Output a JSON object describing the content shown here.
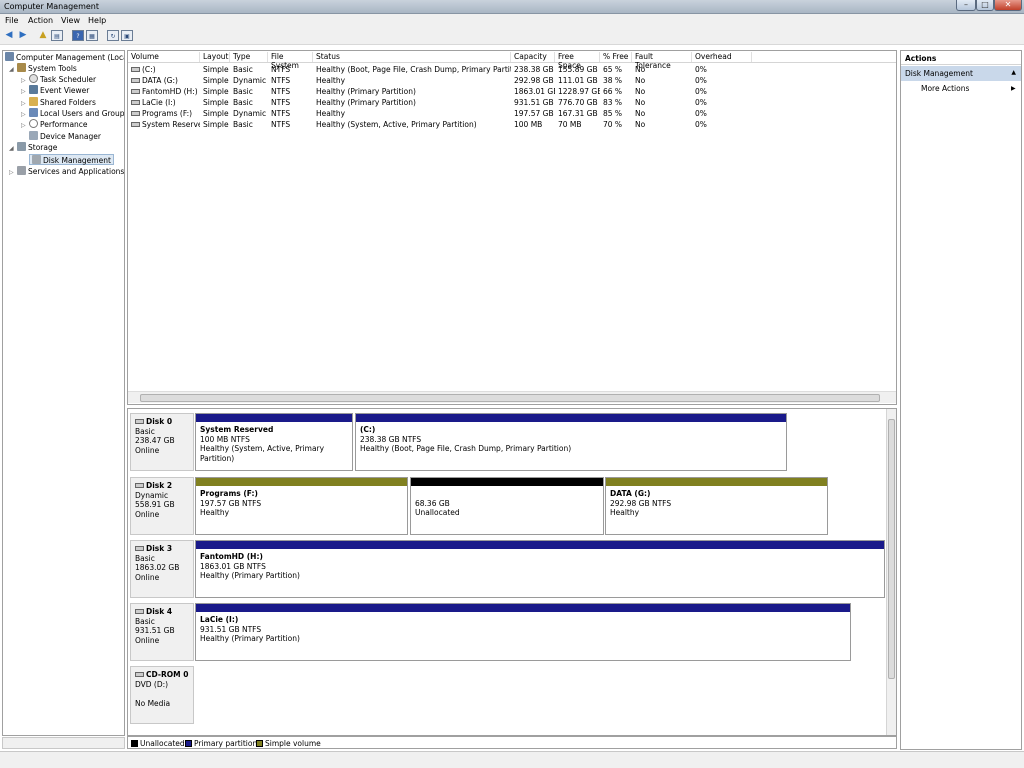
{
  "window": {
    "title": "Computer Management"
  },
  "menu": [
    "File",
    "Action",
    "View",
    "Help"
  ],
  "tree": {
    "root": "Computer Management (Local",
    "items": [
      {
        "label": "System Tools",
        "level": 1
      },
      {
        "label": "Task Scheduler",
        "level": 2
      },
      {
        "label": "Event Viewer",
        "level": 2
      },
      {
        "label": "Shared Folders",
        "level": 2
      },
      {
        "label": "Local Users and Groups",
        "level": 2
      },
      {
        "label": "Performance",
        "level": 2
      },
      {
        "label": "Device Manager",
        "level": 2
      },
      {
        "label": "Storage",
        "level": 1
      },
      {
        "label": "Disk Management",
        "level": 2
      },
      {
        "label": "Services and Applications",
        "level": 1
      }
    ]
  },
  "volumes": {
    "columns": [
      "Volume",
      "Layout",
      "Type",
      "File System",
      "Status",
      "Capacity",
      "Free Space",
      "% Free",
      "Fault Tolerance",
      "Overhead"
    ],
    "rows": [
      [
        "(C:)",
        "Simple",
        "Basic",
        "NTFS",
        "Healthy (Boot, Page File, Crash Dump, Primary Partition)",
        "238.38 GB",
        "155.89 GB",
        "65 %",
        "No",
        "0%"
      ],
      [
        "DATA (G:)",
        "Simple",
        "Dynamic",
        "NTFS",
        "Healthy",
        "292.98 GB",
        "111.01 GB",
        "38 %",
        "No",
        "0%"
      ],
      [
        "FantomHD (H:)",
        "Simple",
        "Basic",
        "NTFS",
        "Healthy (Primary Partition)",
        "1863.01 GB",
        "1228.97 GB",
        "66 %",
        "No",
        "0%"
      ],
      [
        "LaCie (I:)",
        "Simple",
        "Basic",
        "NTFS",
        "Healthy (Primary Partition)",
        "931.51 GB",
        "776.70 GB",
        "83 %",
        "No",
        "0%"
      ],
      [
        "Programs (F:)",
        "Simple",
        "Dynamic",
        "NTFS",
        "Healthy",
        "197.57 GB",
        "167.31 GB",
        "85 %",
        "No",
        "0%"
      ],
      [
        "System Reserved",
        "Simple",
        "Basic",
        "NTFS",
        "Healthy (System, Active, Primary Partition)",
        "100 MB",
        "70 MB",
        "70 %",
        "No",
        "0%"
      ]
    ]
  },
  "disks": [
    {
      "name": "Disk 0",
      "type": "Basic",
      "size": "238.47 GB",
      "state": "Online",
      "partitions": [
        {
          "title": "System Reserved",
          "info": "100 MB NTFS",
          "status": "Healthy (System, Active, Primary Partition)",
          "kind": "primary"
        },
        {
          "title": "(C:)",
          "info": "238.38 GB NTFS",
          "status": "Healthy (Boot, Page File, Crash Dump, Primary Partition)",
          "kind": "primary"
        }
      ]
    },
    {
      "name": "Disk 2",
      "type": "Dynamic",
      "size": "558.91 GB",
      "state": "Online",
      "partitions": [
        {
          "title": "Programs  (F:)",
          "info": "197.57 GB NTFS",
          "status": "Healthy",
          "kind": "simple"
        },
        {
          "title": "",
          "info": "68.36 GB",
          "status": "Unallocated",
          "kind": "unalloc"
        },
        {
          "title": "DATA  (G:)",
          "info": "292.98 GB NTFS",
          "status": "Healthy",
          "kind": "simple"
        }
      ]
    },
    {
      "name": "Disk 3",
      "type": "Basic",
      "size": "1863.02 GB",
      "state": "Online",
      "partitions": [
        {
          "title": "FantomHD  (H:)",
          "info": "1863.01 GB NTFS",
          "status": "Healthy (Primary Partition)",
          "kind": "primary"
        }
      ]
    },
    {
      "name": "Disk 4",
      "type": "Basic",
      "size": "931.51 GB",
      "state": "Online",
      "partitions": [
        {
          "title": "LaCie  (I:)",
          "info": "931.51 GB NTFS",
          "status": "Healthy (Primary Partition)",
          "kind": "primary"
        }
      ]
    },
    {
      "name": "CD-ROM 0",
      "type": "DVD (D:)",
      "size": "",
      "state": "No Media",
      "partitions": []
    }
  ],
  "legend": [
    "Unallocated",
    "Primary partition",
    "Simple volume"
  ],
  "actions": {
    "header": "Actions",
    "section": "Disk Management",
    "more": "More Actions"
  },
  "colors": {
    "primary": "#1a1a8a",
    "simple": "#808020",
    "unallocated": "#000000"
  }
}
